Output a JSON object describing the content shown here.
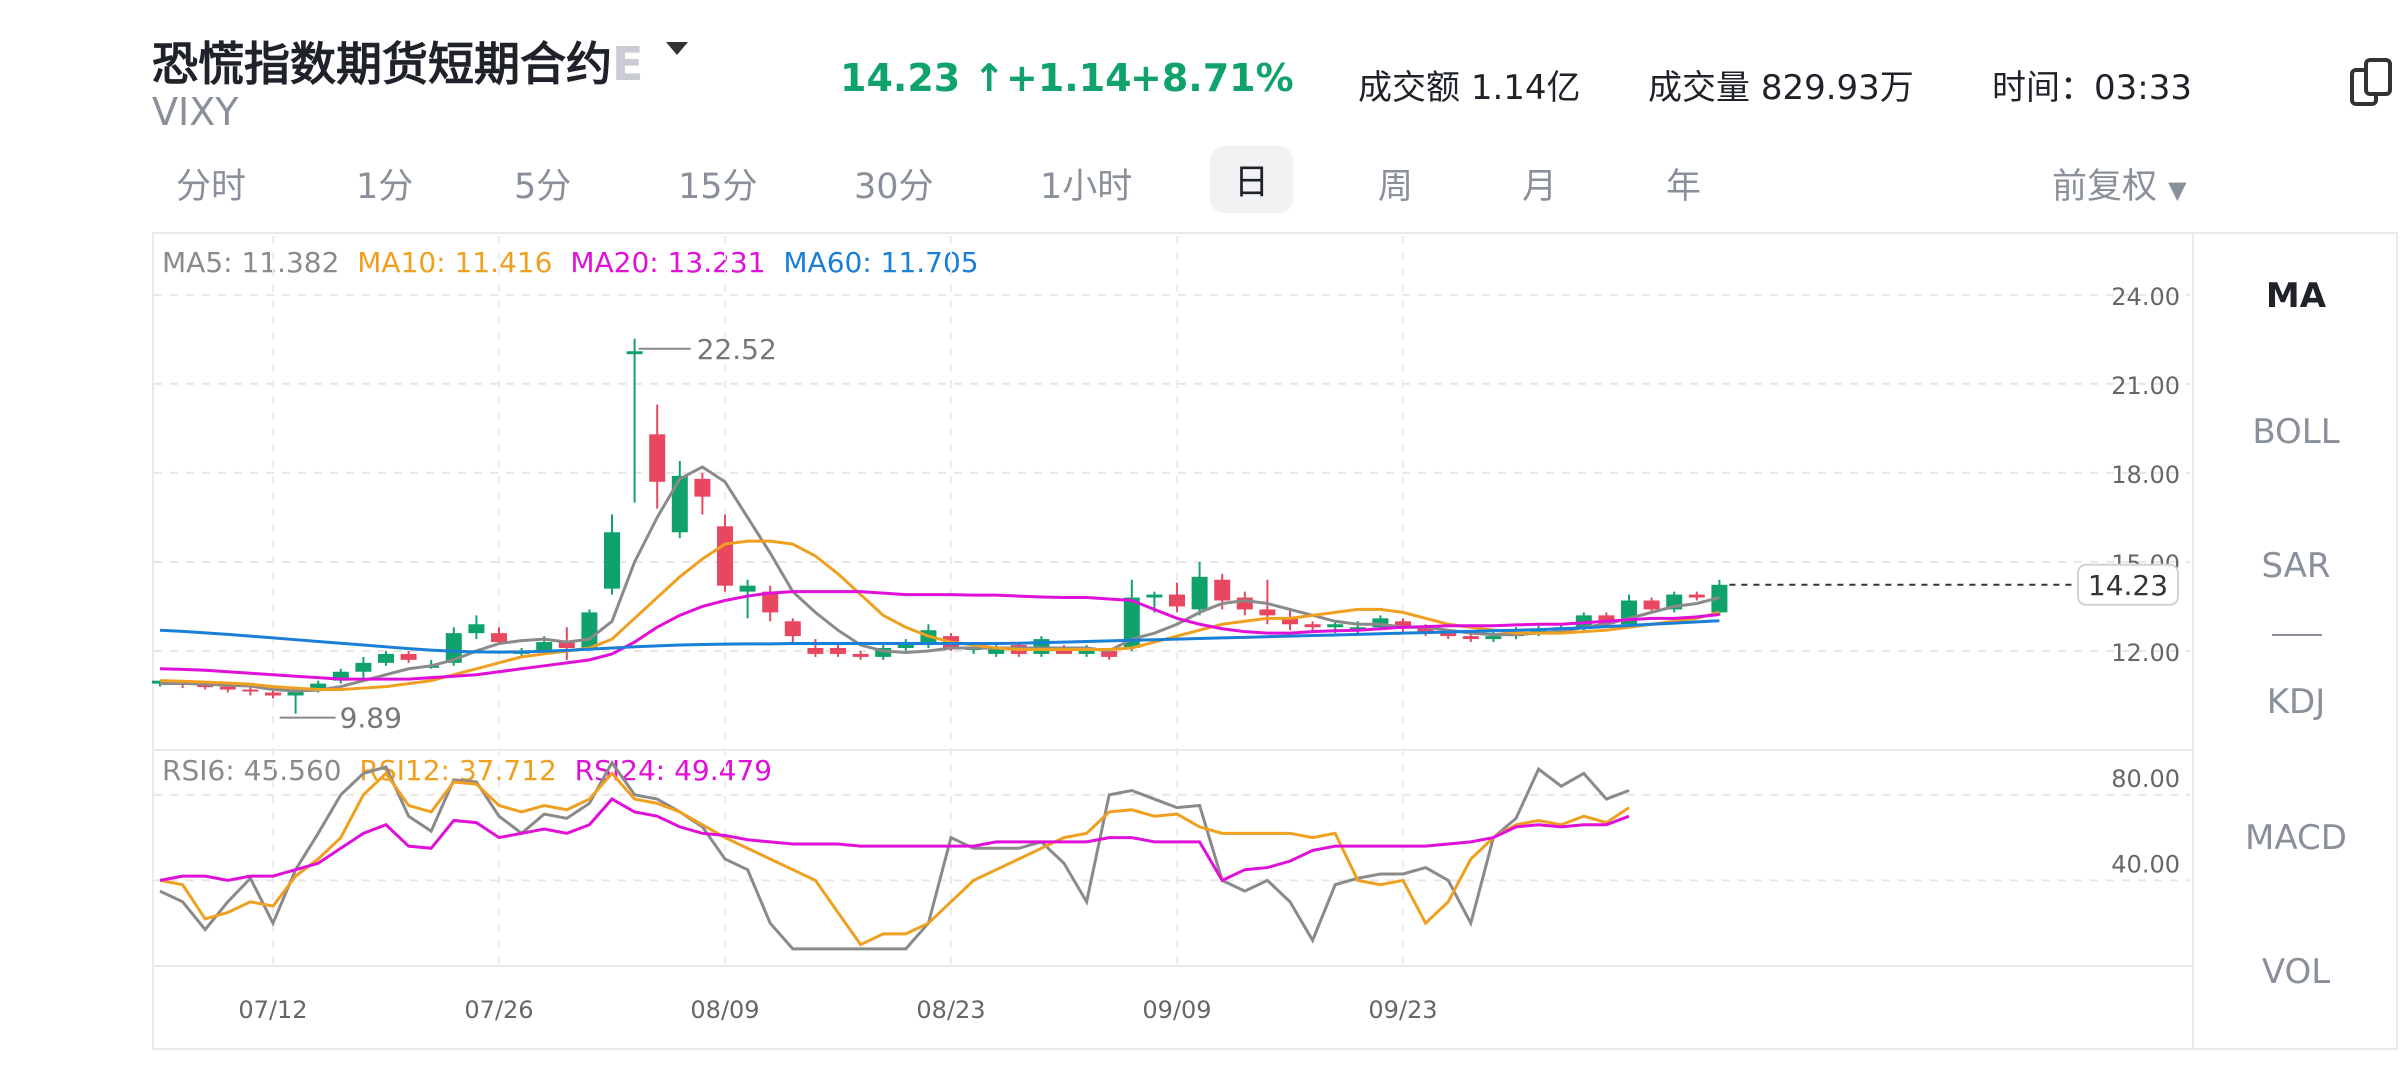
{
  "header": {
    "title": "恐慌指数期货短期合约",
    "title_fade": "E",
    "ticker": "VIXY",
    "price": "14.23 ↑",
    "change": "+1.14",
    "change_pct": "+8.71%",
    "turnover_label": "成交额",
    "turnover_value": "1.14亿",
    "volume_label": "成交量",
    "volume_value": "829.93万",
    "time_label": "时间：",
    "time_value": "03:33"
  },
  "tabs": [
    "分时",
    "1分",
    "5分",
    "15分",
    "30分",
    "1小时",
    "日",
    "周",
    "月",
    "年"
  ],
  "active_tab": "日",
  "adjust": "前复权",
  "indicators": [
    "MA",
    "BOLL",
    "SAR",
    "KDJ",
    "MACD",
    "VOL"
  ],
  "active_indicator": "MA",
  "legend_main": [
    {
      "text": "MA5: 11.382",
      "color": "#8a8a8a"
    },
    {
      "text": "MA10: 11.416",
      "color": "#f0a020"
    },
    {
      "text": "MA20: 13.231",
      "color": "#e010d8"
    },
    {
      "text": "MA60: 11.705",
      "color": "#1a7fd6"
    }
  ],
  "legend_rsi": [
    {
      "text": "RSI6: 45.560",
      "color": "#8a8a8a"
    },
    {
      "text": "RSI12: 37.712",
      "color": "#f0a020"
    },
    {
      "text": "RSI24: 49.479",
      "color": "#e010d8"
    }
  ],
  "colors": {
    "up": "#0fa36b",
    "down": "#e8475f"
  },
  "chart_data": {
    "type": "candlestick",
    "y_ticks": [
      "24.00",
      "21.00",
      "18.00",
      "15.00",
      "12.00"
    ],
    "ylim": [
      9.0,
      24.5
    ],
    "rsi_ticks": [
      "80.00",
      "40.00"
    ],
    "rsi_ylim": [
      0,
      100
    ],
    "x_ticks": [
      "07/12",
      "07/26",
      "08/09",
      "08/23",
      "09/09",
      "09/23"
    ],
    "x_tick_index": [
      5,
      15,
      25,
      35,
      45,
      55
    ],
    "max_label": "22.52",
    "max_index": 21,
    "min_label": "9.89",
    "min_index": 6,
    "last_price": "14.23",
    "candles": [
      [
        10.9,
        11.0,
        10.8,
        10.95
      ],
      [
        10.95,
        10.9,
        10.75,
        11.0
      ],
      [
        10.85,
        10.8,
        10.7,
        10.95
      ],
      [
        10.8,
        10.7,
        10.6,
        10.9
      ],
      [
        10.7,
        10.65,
        10.5,
        10.8
      ],
      [
        10.6,
        10.5,
        10.4,
        10.7
      ],
      [
        10.5,
        10.7,
        9.89,
        10.8
      ],
      [
        10.7,
        10.9,
        10.6,
        11.0
      ],
      [
        11.0,
        11.3,
        10.9,
        11.4
      ],
      [
        11.3,
        11.6,
        11.1,
        11.8
      ],
      [
        11.6,
        11.9,
        11.5,
        12.0
      ],
      [
        11.9,
        11.7,
        11.6,
        12.0
      ],
      [
        11.5,
        11.5,
        11.4,
        11.7
      ],
      [
        11.6,
        12.6,
        11.5,
        12.8
      ],
      [
        12.6,
        12.9,
        12.4,
        13.2
      ],
      [
        12.6,
        12.3,
        12.2,
        12.8
      ],
      [
        11.9,
        12.0,
        11.8,
        12.1
      ],
      [
        12.0,
        12.3,
        11.9,
        12.5
      ],
      [
        12.3,
        12.1,
        11.7,
        12.8
      ],
      [
        12.1,
        13.3,
        12.0,
        13.4
      ],
      [
        14.1,
        16.0,
        13.9,
        16.6
      ],
      [
        22.0,
        22.1,
        17.0,
        22.52
      ],
      [
        19.3,
        17.7,
        16.8,
        20.3
      ],
      [
        16.0,
        17.9,
        15.8,
        18.4
      ],
      [
        17.8,
        17.2,
        16.6,
        18.0
      ],
      [
        16.2,
        14.2,
        14.0,
        16.6
      ],
      [
        14.0,
        14.2,
        13.1,
        14.4
      ],
      [
        14.0,
        13.3,
        13.0,
        14.2
      ],
      [
        13.0,
        12.5,
        12.2,
        13.1
      ],
      [
        12.1,
        11.9,
        11.8,
        12.4
      ],
      [
        12.1,
        11.9,
        11.8,
        12.2
      ],
      [
        11.9,
        11.8,
        11.7,
        12.0
      ],
      [
        11.8,
        12.1,
        11.7,
        12.2
      ],
      [
        12.1,
        12.2,
        12.0,
        12.4
      ],
      [
        12.2,
        12.7,
        12.1,
        12.9
      ],
      [
        12.5,
        12.1,
        12.0,
        12.6
      ],
      [
        12.1,
        12.1,
        11.9,
        12.2
      ],
      [
        11.9,
        12.1,
        11.8,
        12.2
      ],
      [
        12.2,
        11.9,
        11.8,
        12.3
      ],
      [
        11.9,
        12.4,
        11.8,
        12.5
      ],
      [
        12.1,
        11.9,
        11.9,
        12.2
      ],
      [
        11.9,
        12.1,
        11.8,
        12.2
      ],
      [
        12.0,
        11.8,
        11.7,
        12.0
      ],
      [
        12.1,
        13.8,
        12.0,
        14.4
      ],
      [
        13.8,
        13.9,
        13.3,
        14.0
      ],
      [
        13.9,
        13.5,
        13.3,
        14.3
      ],
      [
        13.4,
        14.5,
        13.2,
        15.0
      ],
      [
        14.4,
        13.7,
        13.4,
        14.6
      ],
      [
        13.8,
        13.4,
        13.2,
        14.0
      ],
      [
        13.4,
        13.2,
        12.9,
        14.4
      ],
      [
        13.1,
        12.9,
        12.7,
        13.4
      ],
      [
        12.9,
        12.8,
        12.6,
        13.0
      ],
      [
        12.8,
        12.9,
        12.6,
        13.0
      ],
      [
        12.8,
        12.8,
        12.6,
        13.0
      ],
      [
        12.8,
        13.1,
        12.7,
        13.2
      ],
      [
        13.0,
        12.8,
        12.6,
        13.1
      ],
      [
        12.8,
        12.6,
        12.5,
        12.9
      ],
      [
        12.6,
        12.5,
        12.4,
        12.7
      ],
      [
        12.5,
        12.4,
        12.3,
        12.6
      ],
      [
        12.4,
        12.5,
        12.3,
        12.7
      ],
      [
        12.5,
        12.6,
        12.4,
        12.8
      ],
      [
        12.7,
        12.7,
        12.5,
        12.9
      ],
      [
        12.7,
        12.8,
        12.6,
        12.9
      ],
      [
        12.8,
        13.2,
        12.7,
        13.3
      ],
      [
        13.2,
        12.9,
        12.8,
        13.3
      ],
      [
        12.9,
        13.7,
        12.8,
        13.9
      ],
      [
        13.7,
        13.4,
        13.3,
        13.8
      ],
      [
        13.4,
        13.9,
        13.3,
        14.0
      ],
      [
        13.9,
        13.8,
        13.7,
        14.0
      ],
      [
        13.3,
        14.23,
        13.2,
        14.4
      ]
    ],
    "series": [
      {
        "name": "MA5",
        "color": "#8a8a8a",
        "values": [
          10.9,
          10.91,
          10.88,
          10.85,
          10.82,
          10.7,
          10.65,
          10.68,
          10.8,
          11.0,
          11.2,
          11.4,
          11.5,
          11.7,
          12.0,
          12.25,
          12.35,
          12.4,
          12.3,
          12.4,
          13.0,
          15.0,
          16.5,
          17.8,
          18.2,
          17.7,
          16.5,
          15.3,
          14.0,
          13.3,
          12.7,
          12.2,
          12.0,
          11.95,
          12.0,
          12.1,
          12.1,
          12.1,
          12.1,
          12.1,
          12.1,
          12.1,
          12.0,
          12.4,
          12.6,
          12.9,
          13.3,
          13.6,
          13.7,
          13.6,
          13.4,
          13.2,
          13.0,
          12.9,
          12.9,
          12.8,
          12.8,
          12.7,
          12.6,
          12.55,
          12.55,
          12.6,
          12.65,
          12.8,
          12.9,
          13.1,
          13.3,
          13.5,
          13.6,
          13.8
        ]
      },
      {
        "name": "MA10",
        "color": "#f0a020",
        "values": [
          11.0,
          10.98,
          10.95,
          10.92,
          10.88,
          10.8,
          10.75,
          10.7,
          10.7,
          10.75,
          10.8,
          10.9,
          11.0,
          11.2,
          11.4,
          11.6,
          11.8,
          11.9,
          12.0,
          12.1,
          12.4,
          13.1,
          13.8,
          14.5,
          15.1,
          15.6,
          15.7,
          15.7,
          15.6,
          15.2,
          14.6,
          13.9,
          13.2,
          12.8,
          12.5,
          12.3,
          12.2,
          12.1,
          12.05,
          12.05,
          12.05,
          12.05,
          12.05,
          12.1,
          12.3,
          12.5,
          12.7,
          12.9,
          13.0,
          13.1,
          13.1,
          13.2,
          13.3,
          13.4,
          13.4,
          13.3,
          13.1,
          12.9,
          12.8,
          12.7,
          12.6,
          12.6,
          12.6,
          12.65,
          12.7,
          12.8,
          12.9,
          13.0,
          13.1,
          13.3
        ]
      },
      {
        "name": "MA20",
        "color": "#e010d8",
        "values": [
          11.4,
          11.38,
          11.35,
          11.3,
          11.25,
          11.2,
          11.15,
          11.1,
          11.05,
          11.05,
          11.05,
          11.05,
          11.1,
          11.15,
          11.2,
          11.3,
          11.4,
          11.5,
          11.6,
          11.7,
          11.9,
          12.3,
          12.8,
          13.2,
          13.5,
          13.7,
          13.85,
          13.95,
          14.0,
          14.0,
          14.0,
          14.0,
          13.95,
          13.9,
          13.9,
          13.9,
          13.88,
          13.88,
          13.85,
          13.82,
          13.8,
          13.8,
          13.75,
          13.7,
          13.4,
          13.1,
          12.9,
          12.75,
          12.65,
          12.6,
          12.6,
          12.65,
          12.68,
          12.7,
          12.75,
          12.8,
          12.82,
          12.85,
          12.85,
          12.85,
          12.88,
          12.9,
          12.9,
          12.95,
          13.0,
          13.05,
          13.1,
          13.1,
          13.15,
          13.23
        ]
      },
      {
        "name": "MA60",
        "color": "#1a7fd6",
        "values": [
          12.7,
          12.66,
          12.61,
          12.56,
          12.5,
          12.44,
          12.38,
          12.32,
          12.26,
          12.2,
          12.14,
          12.08,
          12.03,
          11.99,
          11.97,
          11.96,
          11.97,
          11.99,
          12.02,
          12.06,
          12.1,
          12.14,
          12.17,
          12.2,
          12.22,
          12.23,
          12.24,
          12.24,
          12.25,
          12.25,
          12.25,
          12.25,
          12.25,
          12.25,
          12.25,
          12.25,
          12.25,
          12.25,
          12.26,
          12.28,
          12.3,
          12.32,
          12.34,
          12.36,
          12.38,
          12.4,
          12.42,
          12.44,
          12.46,
          12.48,
          12.5,
          12.52,
          12.54,
          12.56,
          12.58,
          12.6,
          12.62,
          12.64,
          12.66,
          12.68,
          12.7,
          12.72,
          12.75,
          12.78,
          12.82,
          12.86,
          12.9,
          12.94,
          12.98,
          13.02
        ]
      }
    ],
    "rsi_series": [
      {
        "name": "RSI6",
        "color": "#8a8a8a",
        "values": [
          35,
          30,
          17,
          30,
          41,
          20,
          45,
          62,
          80,
          90,
          93,
          70,
          63,
          87,
          86,
          70,
          62,
          71,
          69,
          76,
          95,
          80,
          78,
          72,
          65,
          50,
          45,
          20,
          8,
          8,
          8,
          8,
          8,
          8,
          20,
          60,
          55,
          55,
          55,
          58,
          48,
          30,
          80,
          82,
          78,
          74,
          75,
          40,
          35,
          40,
          30,
          12,
          38,
          41,
          43,
          43,
          46,
          40,
          20,
          60,
          69,
          92,
          84,
          90,
          78,
          82
        ]
      },
      {
        "name": "RSI12",
        "color": "#f0a020",
        "values": [
          40,
          38,
          22,
          25,
          30,
          28,
          42,
          50,
          60,
          80,
          90,
          75,
          72,
          86,
          85,
          75,
          72,
          75,
          73,
          78,
          90,
          78,
          76,
          72,
          66,
          60,
          55,
          50,
          45,
          40,
          25,
          10,
          15,
          15,
          20,
          30,
          40,
          45,
          50,
          55,
          60,
          62,
          72,
          73,
          70,
          71,
          65,
          62,
          62,
          62,
          62,
          60,
          62,
          40,
          38,
          40,
          20,
          30,
          50,
          60,
          66,
          68,
          66,
          70,
          67,
          74
        ]
      },
      {
        "name": "RSI24",
        "color": "#e010d8",
        "values": [
          40,
          42,
          42,
          40,
          42,
          42,
          45,
          48,
          55,
          62,
          66,
          56,
          55,
          68,
          67,
          60,
          62,
          64,
          62,
          66,
          78,
          72,
          70,
          65,
          62,
          61,
          59,
          58,
          57,
          57,
          57,
          56,
          56,
          56,
          56,
          56,
          56,
          58,
          58,
          58,
          58,
          58,
          60,
          60,
          58,
          58,
          58,
          40,
          45,
          46,
          49,
          54,
          56,
          56,
          56,
          56,
          56,
          57,
          58,
          60,
          65,
          66,
          65,
          66,
          66,
          70
        ]
      }
    ]
  }
}
